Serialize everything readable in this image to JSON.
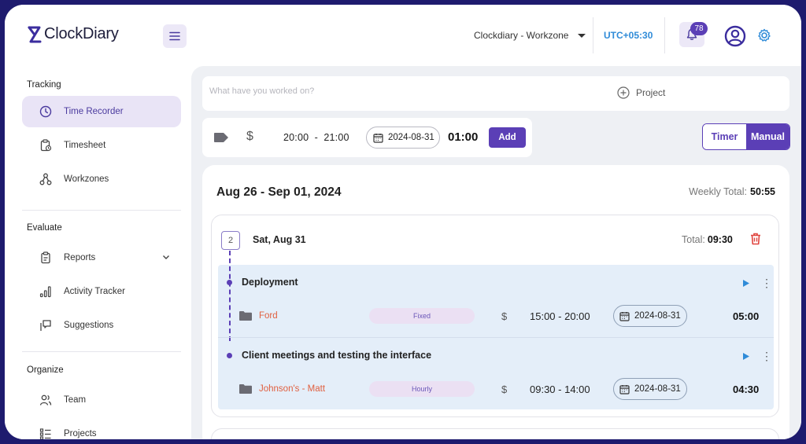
{
  "app": {
    "name": "ClockDiary",
    "workzone": "Clockdiary - Workzone",
    "timezone": "UTC+05:30",
    "notification_count": "78"
  },
  "sidebar": {
    "sections": [
      {
        "title": "Tracking",
        "items": [
          {
            "label": "Time Recorder",
            "icon": "clock-icon",
            "active": true
          },
          {
            "label": "Timesheet",
            "icon": "clipboard-clock-icon"
          },
          {
            "label": "Workzones",
            "icon": "hierarchy-icon"
          }
        ]
      },
      {
        "title": "Evaluate",
        "items": [
          {
            "label": "Reports",
            "icon": "clipboard-icon",
            "expandable": true
          },
          {
            "label": "Activity Tracker",
            "icon": "bar-chart-icon"
          },
          {
            "label": "Suggestions",
            "icon": "message-flag-icon"
          }
        ]
      },
      {
        "title": "Organize",
        "items": [
          {
            "label": "Team",
            "icon": "team-icon"
          },
          {
            "label": "Projects",
            "icon": "list-icon"
          }
        ]
      }
    ]
  },
  "entry_form": {
    "description_placeholder": "What have you worked on?",
    "project_label": "Project",
    "currency": "$",
    "start_time": "20:00",
    "end_time": "21:00",
    "time_separator": "-",
    "date": "2024-08-31",
    "duration": "01:00",
    "add_label": "Add",
    "mode_timer": "Timer",
    "mode_manual": "Manual",
    "active_mode": "Manual"
  },
  "week": {
    "range": "Aug 26 - Sep 01, 2024",
    "total_label": "Weekly Total:",
    "total": "50:55"
  },
  "day": {
    "entry_count": "2",
    "label": "Sat, Aug 31",
    "total_label": "Total:",
    "total": "09:30",
    "entries": [
      {
        "title": "Deployment",
        "project": "Ford",
        "rate": "Fixed",
        "currency": "$",
        "times": "15:00 - 20:00",
        "date": "2024-08-31",
        "duration": "05:00"
      },
      {
        "title": "Client meetings and testing the interface",
        "project": "Johnson's - Matt",
        "rate": "Hourly",
        "currency": "$",
        "times": "09:30 - 14:00",
        "date": "2024-08-31",
        "duration": "04:30"
      }
    ]
  },
  "colors": {
    "accent": "#5b3fb6",
    "active_nav_bg": "#e9e4f6",
    "utc_blue": "#2f8bd8",
    "project_orange": "#e06040",
    "delete_red": "#e0443e",
    "entries_bg": "#e4eef9",
    "outer_border": "#1e1b6e"
  }
}
